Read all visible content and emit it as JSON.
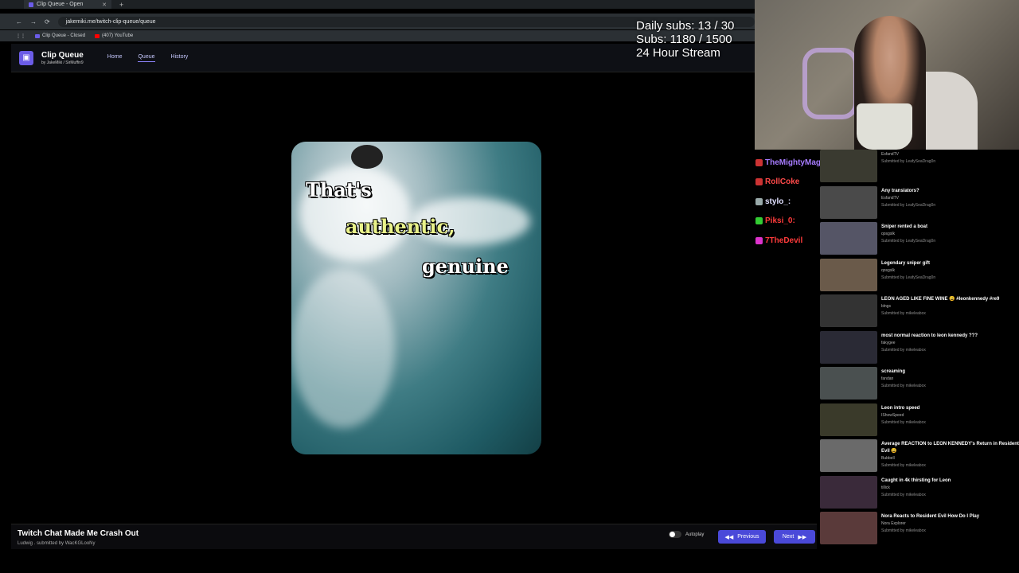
{
  "browser": {
    "tab_title": "Clip Queue - Open",
    "url": "jakemiki.me/twitch-clip-queue/queue",
    "bookmarks": [
      "Clip Queue - Closed",
      "(407) YouTube"
    ]
  },
  "app": {
    "title": "Clip Queue",
    "byline": "by JakeMiki / SirMuffin9",
    "nav": [
      "Home",
      "Queue",
      "History"
    ],
    "active_nav": "Queue"
  },
  "overlay": {
    "line1": "Daily subs: 13 / 30",
    "line2": "Subs: 1180 / 1500",
    "line3": "24 Hour Stream"
  },
  "video": {
    "captions": [
      "That's",
      "authentic,",
      "genuine"
    ]
  },
  "chat": [
    {
      "name": "TheMightyMag",
      "color": "#a77cff"
    },
    {
      "name": "RollCoke",
      "color": "#ff4a4a"
    },
    {
      "name": "stylo_:",
      "color": "#e0e0ff"
    },
    {
      "name": "Piksi_0:",
      "color": "#ff3b3b"
    },
    {
      "name": "7TheDevil",
      "color": "#ff3b3b"
    }
  ],
  "queue": [
    {
      "title": "",
      "channel": "EsfandTV",
      "submitter": "Submitted by LeafySeaDrag0n"
    },
    {
      "title": "Any translators?",
      "channel": "EsfandTV",
      "submitter": "Submitted by LeafySeaDrag0n"
    },
    {
      "title": "Sniper rented a boat",
      "channel": "qosgslk",
      "submitter": "Submitted by LeafySeaDrag0n"
    },
    {
      "title": "Legendary sniper gift",
      "channel": "qosgslk",
      "submitter": "Submitted by LeafySeaDrag0n"
    },
    {
      "title": "LEON AGED LIKE FINE WINE 😩 #leonkennedy #re9",
      "channel": "blngs",
      "submitter": "Submitted by mikeleabox"
    },
    {
      "title": "most normal reaction to leon kennedy ???",
      "channel": "fakygee",
      "submitter": "Submitted by mikeleabox"
    },
    {
      "title": "screaming",
      "channel": "fandan",
      "submitter": "Submitted by mikeleabox"
    },
    {
      "title": "Leon intro speed",
      "channel": "IShowSpeed",
      "submitter": "Submitted by mikeleabox"
    },
    {
      "title": "Average REACTION to LEON KENNEDY's Return in Resident Evil 😩",
      "channel": "Bubbell",
      "submitter": "Submitted by mikeleabox"
    },
    {
      "title": "Caught in 4k thirsting for Leon",
      "channel": "tillick",
      "submitter": "Submitted by mikeleabox"
    },
    {
      "title": "Nora Reacts to Resident Evil How Do I Play",
      "channel": "Nora Explorer",
      "submitter": "Submitted by mikeleabox"
    }
  ],
  "current_clip": {
    "title": "Twitch Chat Made Me Crash Out",
    "subtitle": "Ludwig . submitted by WacKGLooNy"
  },
  "controls": {
    "autoplay_label": "Autoplay",
    "autoplay_on": false,
    "prev_label": "Previous",
    "next_label": "Next"
  }
}
